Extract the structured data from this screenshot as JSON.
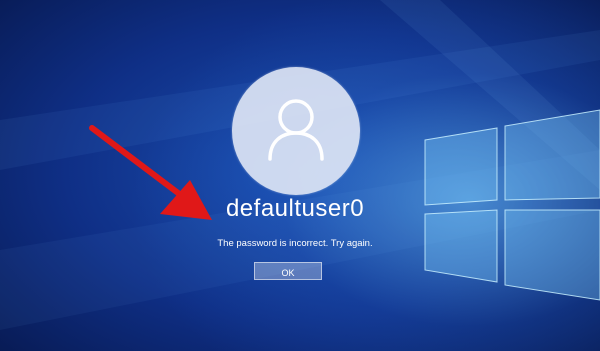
{
  "lock_screen": {
    "username": "defaultuser0",
    "error_message": "The password is incorrect. Try again.",
    "ok_label": "OK"
  },
  "icons": {
    "avatar": "user-silhouette-icon",
    "annotation": "red-arrow-icon",
    "logo": "windows-logo-icon"
  },
  "colors": {
    "background": "#0f2f86",
    "glow": "#6ec8ff",
    "arrow": "#e01818",
    "avatar_circle": "#e1e8f6"
  }
}
